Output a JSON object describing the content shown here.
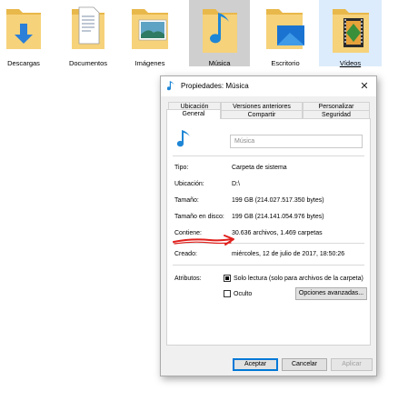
{
  "explorer": {
    "folders": [
      {
        "label": "Descargas",
        "icon": "downloads-folder-icon"
      },
      {
        "label": "Documentos",
        "icon": "documents-folder-icon"
      },
      {
        "label": "Imágenes",
        "icon": "pictures-folder-icon"
      },
      {
        "label": "Música",
        "icon": "music-folder-icon",
        "state": "selected"
      },
      {
        "label": "Escritorio",
        "icon": "desktop-folder-icon"
      },
      {
        "label": "Vídeos",
        "icon": "videos-folder-icon",
        "state": "hover"
      }
    ]
  },
  "dialog": {
    "title": "Propiedades: Música",
    "close_glyph": "✕",
    "tabs_row1": [
      "Ubicación",
      "Versiones anteriores",
      "Personalizar"
    ],
    "tabs_row2": [
      "General",
      "Compartir",
      "Seguridad"
    ],
    "active_tab": "General",
    "name_field_value": "Música",
    "properties": {
      "tipo": {
        "label": "Tipo:",
        "value": "Carpeta de sistema"
      },
      "ubicacion": {
        "label": "Ubicación:",
        "value": "D:\\"
      },
      "tamano": {
        "label": "Tamaño:",
        "value": "199 GB (214.027.517.350 bytes)"
      },
      "tamano_disco": {
        "label": "Tamaño en disco:",
        "value": "199 GB (214.141.054.976 bytes)"
      },
      "contiene": {
        "label": "Contiene:",
        "value": "30.636 archivos, 1.469 carpetas"
      },
      "creado": {
        "label": "Creado:",
        "value": "miércoles, 12 de julio de 2017, 18:50:26"
      }
    },
    "attributes": {
      "label": "Atributos:",
      "readonly_label": "Solo lectura (solo para archivos de la carpeta)",
      "hidden_label": "Oculto",
      "advanced_button": "Opciones avanzadas..."
    },
    "buttons": {
      "accept": "Aceptar",
      "cancel": "Cancelar",
      "apply": "Aplicar"
    }
  },
  "colors": {
    "accent": "#0078d7",
    "folder": "#f6d27a",
    "annotation_arrow": "#e0201c"
  }
}
